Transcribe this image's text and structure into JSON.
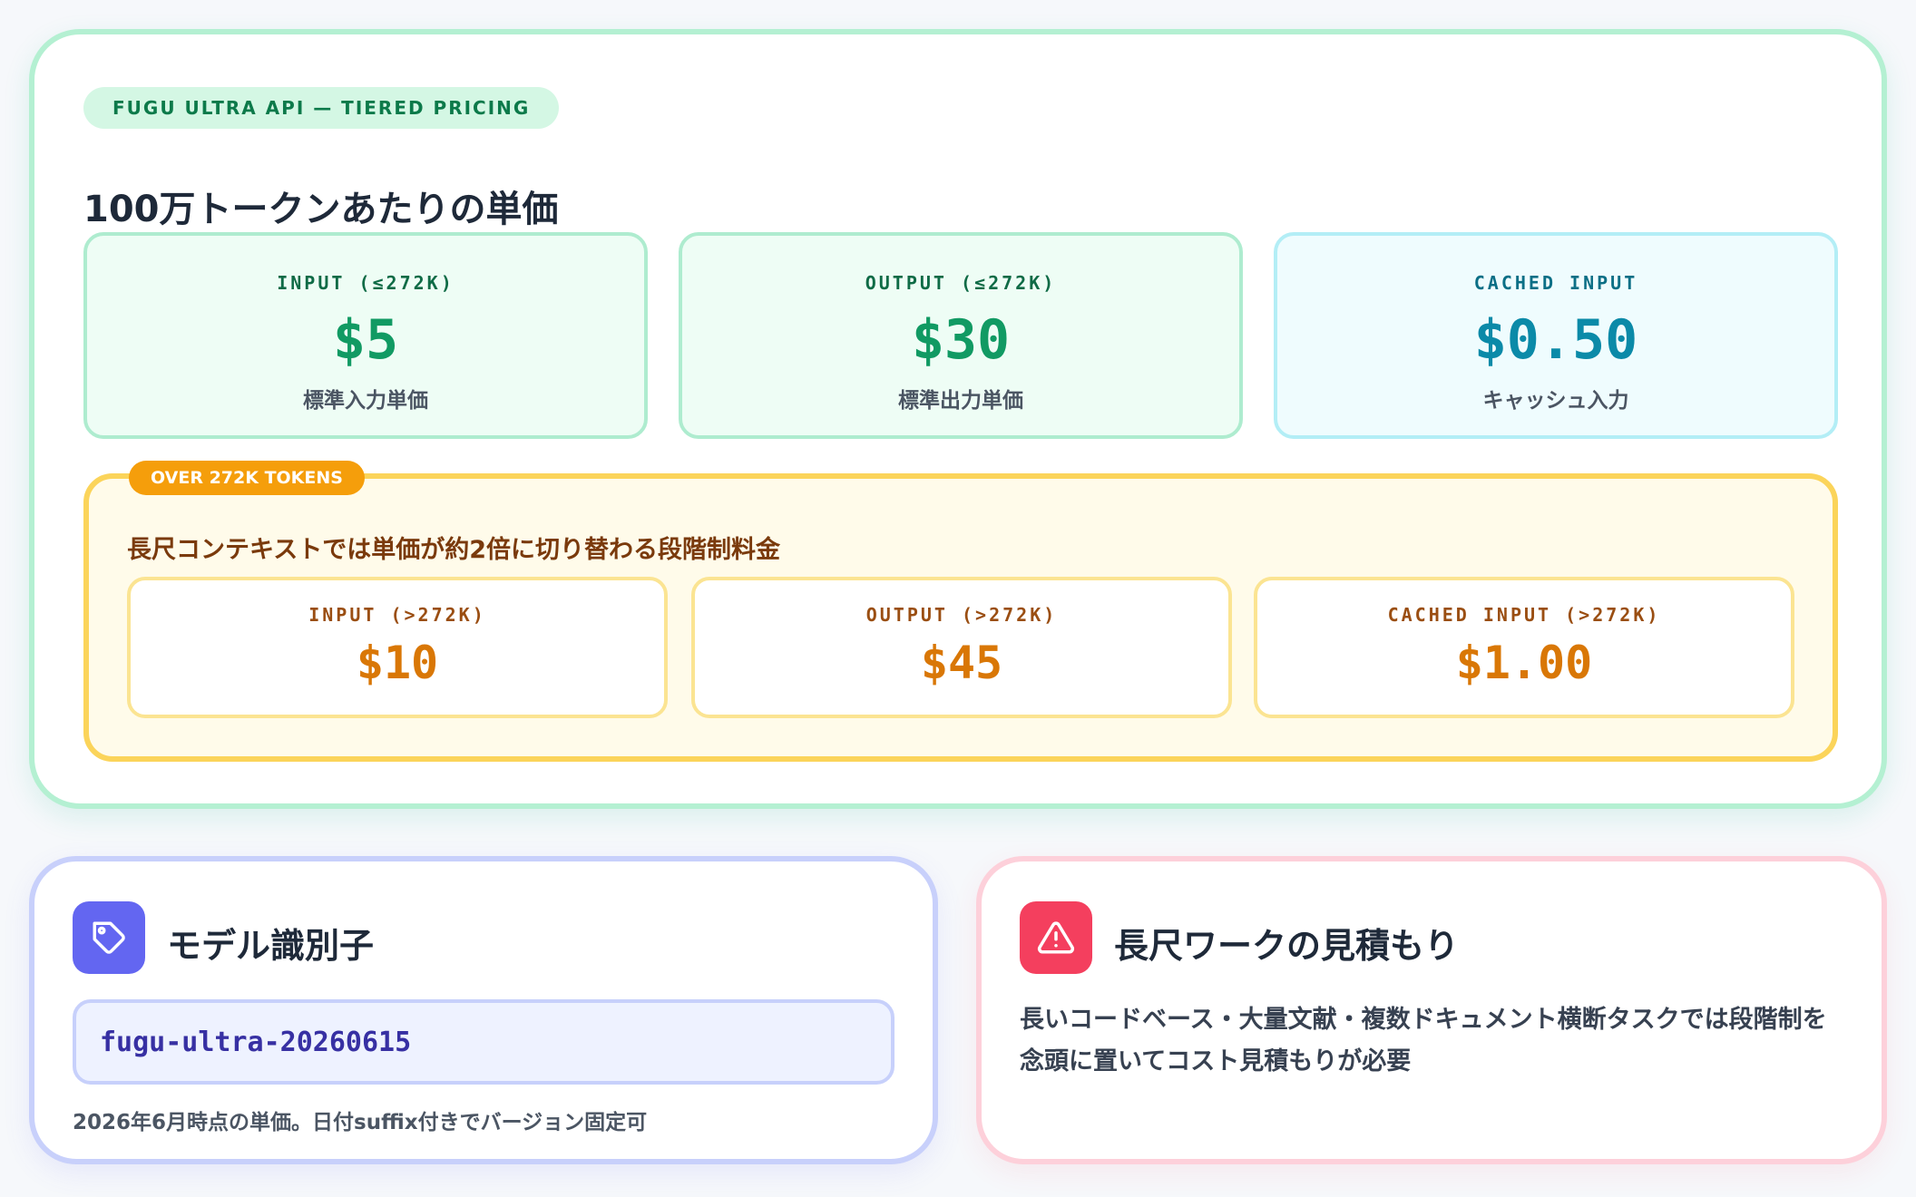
{
  "pricing": {
    "eyebrow": "FUGU ULTRA API — TIERED PRICING",
    "title": "100万トークンあたりの単価",
    "standard": [
      {
        "label": "INPUT (≤272K)",
        "price": "$5",
        "sub": "標準入力単価"
      },
      {
        "label": "OUTPUT (≤272K)",
        "price": "$30",
        "sub": "標準出力単価"
      },
      {
        "label": "CACHED INPUT",
        "price": "$0.50",
        "sub": "キャッシュ入力"
      }
    ],
    "tier": {
      "badge": "OVER 272K TOKENS",
      "description": "長尺コンテキストでは単価が約2倍に切り替わる段階制料金",
      "tiles": [
        {
          "label": "INPUT (>272K)",
          "price": "$10"
        },
        {
          "label": "OUTPUT (>272K)",
          "price": "$45"
        },
        {
          "label": "CACHED INPUT (>272K)",
          "price": "$1.00"
        }
      ]
    }
  },
  "model_card": {
    "icon": "tag-icon",
    "title": "モデル識別子",
    "model_id": "fugu-ultra-20260615",
    "note": "2026年6月時点の単価。日付suffix付きでバージョン固定可"
  },
  "warn_card": {
    "icon": "warning-triangle-icon",
    "title": "長尺ワークの見積もり",
    "body": "長いコードベース・大量文献・複数ドキュメント横断タスクでは段階制を念頭に置いてコスト見積もりが必要"
  },
  "colors": {
    "green_accent": "#119a63",
    "cyan_accent": "#0b8aa8",
    "amber_accent": "#d97706",
    "indigo_icon": "#6366f1",
    "rose_icon": "#f43f5e"
  }
}
